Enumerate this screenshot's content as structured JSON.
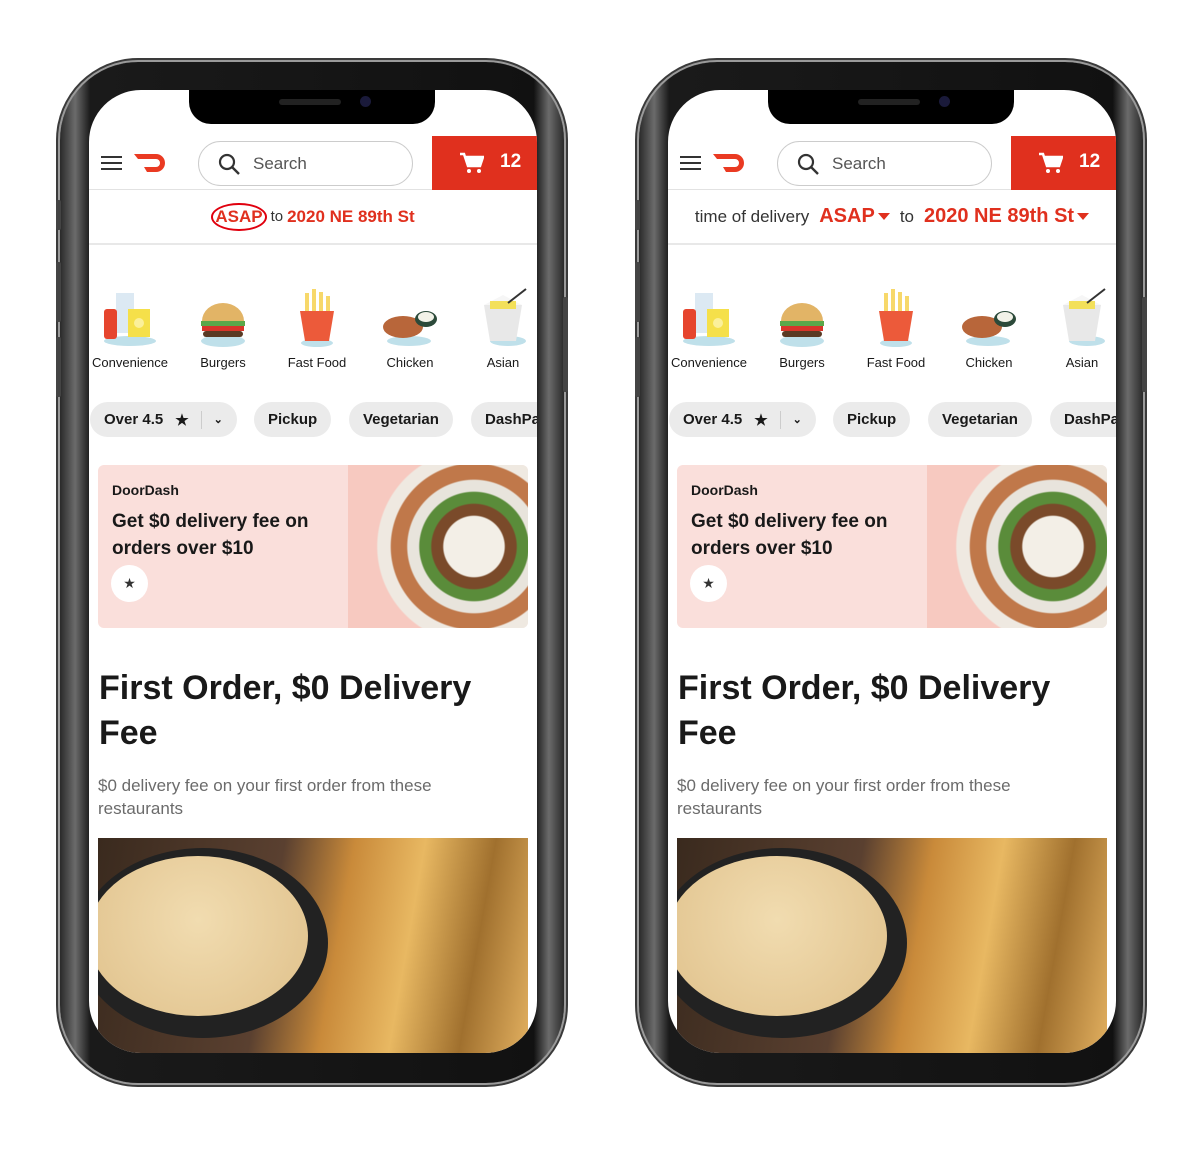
{
  "colors": {
    "brand": "#e0301e",
    "promo_bg": "#fadfdb"
  },
  "phones": [
    {
      "header": {
        "menu_icon": "hamburger-icon",
        "logo": "doordash-logo",
        "search_placeholder": "Search",
        "cart_count": "12"
      },
      "delivery": {
        "prefix": "",
        "time": "ASAP",
        "connector": "to",
        "address": "2020 NE 89th St",
        "time_circled": true,
        "dropdowns": false
      },
      "categories": [
        {
          "label": "Convenience"
        },
        {
          "label": "Burgers"
        },
        {
          "label": "Fast Food"
        },
        {
          "label": "Chicken"
        },
        {
          "label": "Asian"
        }
      ],
      "chips": [
        "Over 4.5",
        "Pickup",
        "Vegetarian",
        "DashPass"
      ],
      "promo": {
        "brand": "DoorDash",
        "title": "Get $0 delivery fee on orders over $10"
      },
      "section": {
        "title": "First Order, $0 Delivery Fee",
        "subtitle": "$0 delivery fee on your first order from these restaurants"
      }
    },
    {
      "header": {
        "menu_icon": "hamburger-icon",
        "logo": "doordash-logo",
        "search_placeholder": "Search",
        "cart_count": "12"
      },
      "delivery": {
        "prefix": "time of delivery",
        "time": "ASAP",
        "connector": "to",
        "address": "2020 NE 89th St",
        "time_circled": false,
        "dropdowns": true
      },
      "categories": [
        {
          "label": "Convenience"
        },
        {
          "label": "Burgers"
        },
        {
          "label": "Fast Food"
        },
        {
          "label": "Chicken"
        },
        {
          "label": "Asian"
        }
      ],
      "chips": [
        "Over 4.5",
        "Pickup",
        "Vegetarian",
        "DashPass"
      ],
      "promo": {
        "brand": "DoorDash",
        "title": "Get $0 delivery fee on orders over $10"
      },
      "section": {
        "title": "First Order, $0 Delivery Fee",
        "subtitle": "$0 delivery fee on your first order from these restaurants"
      }
    }
  ]
}
